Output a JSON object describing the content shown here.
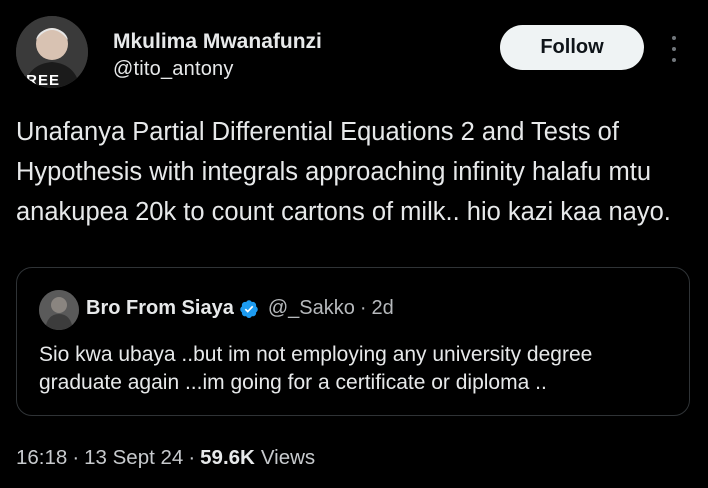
{
  "author": {
    "name": "Mkulima Mwanafunzi",
    "handle": "@tito_antony",
    "avatar_text": "FREE"
  },
  "actions": {
    "follow_label": "Follow",
    "more_icon": "more-vertical-icon"
  },
  "tweet": {
    "text": "Unafanya Partial Differential Equations 2 and Tests of Hypothesis with integrals approaching infinity halafu mtu anakupea 20k to count cartons of milk.. hio kazi kaa nayo."
  },
  "quote": {
    "name": "Bro From Siaya",
    "verified_icon": "verified-badge-icon",
    "handle": "@_Sakko",
    "separator": "·",
    "time": "2d",
    "text": "Sio kwa ubaya ..but im not employing any university degree graduate again ...im going for a certificate or diploma .."
  },
  "meta": {
    "time": "16:18",
    "separator": "·",
    "date": "13 Sept 24",
    "views_count": "59.6K",
    "views_label": "Views"
  },
  "colors": {
    "background": "#000000",
    "text": "#e7e9ea",
    "muted": "#71767b",
    "border": "#2f3336",
    "follow_bg": "#eff3f4",
    "verified": "#1d9bf0"
  }
}
